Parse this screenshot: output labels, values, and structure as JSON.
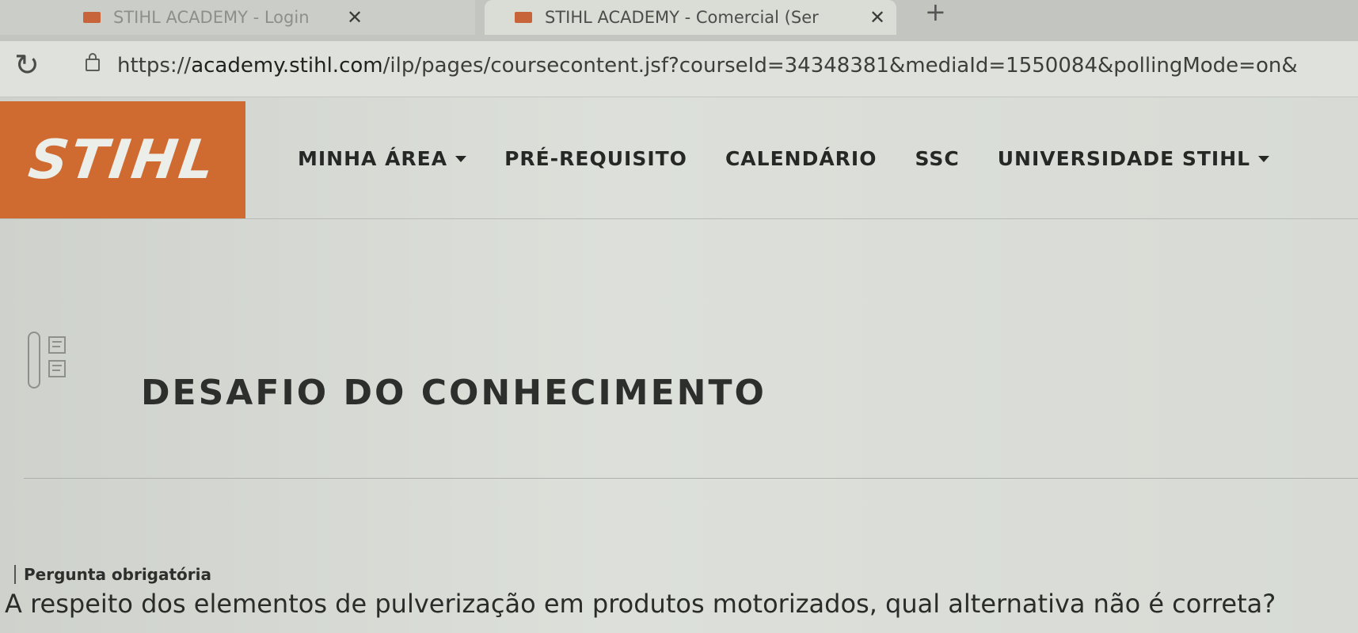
{
  "browser": {
    "tabs": [
      {
        "title": "STIHL ACADEMY - Login",
        "active": false
      },
      {
        "title": "STIHL ACADEMY - Comercial (Ser",
        "active": true
      }
    ],
    "close_glyph": "✕",
    "new_tab_glyph": "+",
    "reload_glyph": "↻",
    "url_prefix": "https://",
    "url_host": "academy.stihl.com",
    "url_rest": "/ilp/pages/coursecontent.jsf?courseId=34348381&mediaId=1550084&pollingMode=on&"
  },
  "header": {
    "logo_text": "STIHL",
    "brand_color": "#cf6a30",
    "nav": [
      {
        "label": "MINHA ÁREA",
        "dropdown": true
      },
      {
        "label": "PRÉ-REQUISITO",
        "dropdown": false
      },
      {
        "label": "CALENDÁRIO",
        "dropdown": false
      },
      {
        "label": "SSC",
        "dropdown": false
      },
      {
        "label": "UNIVERSIDADE STIHL",
        "dropdown": true
      }
    ]
  },
  "content": {
    "section_icon": "quiz-list-icon",
    "section_title": "DESAFIO DO CONHECIMENTO",
    "question_label": "Pergunta obrigatória",
    "question_text": "A respeito dos elementos de pulverização em produtos motorizados, qual alternativa não é correta?"
  }
}
